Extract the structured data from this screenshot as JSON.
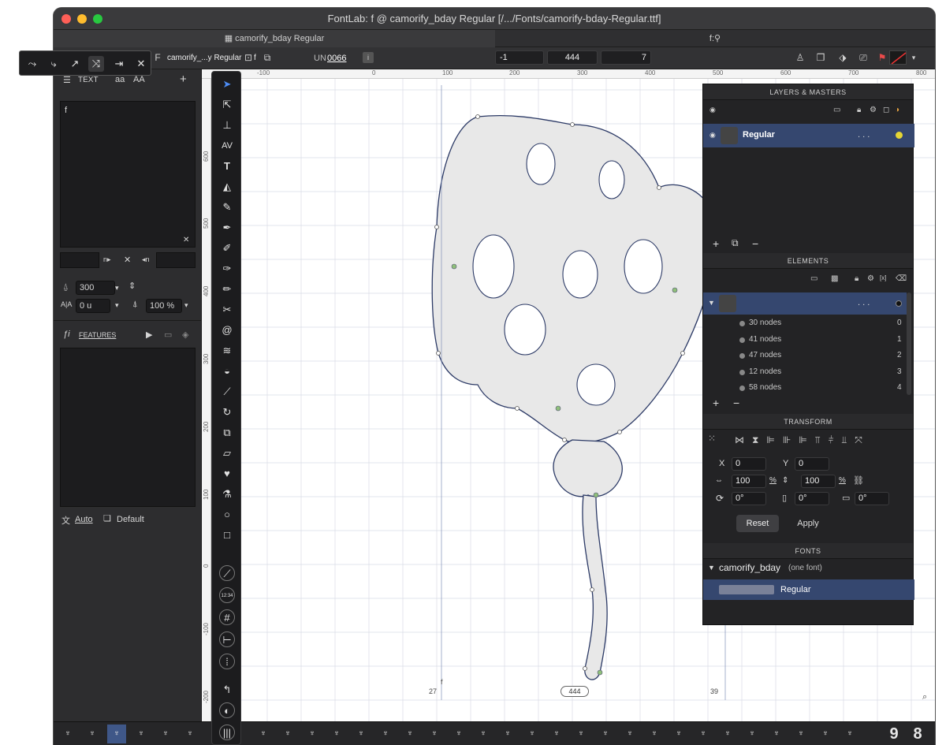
{
  "window": {
    "title": "FontLab: f @ camorify_bday Regular [/.../Fonts/camorify-bday-Regular.ttf]"
  },
  "tabs": [
    {
      "label": "camorify_bday Regular"
    },
    {
      "label": "f:"
    }
  ],
  "toolbar": {
    "font_name": "camorify_...y Regular",
    "glyph_name": "f",
    "un_label": "UN",
    "unicode": "0066",
    "field_a": "-1",
    "field_b": "444",
    "field_c": "7"
  },
  "text_panel": {
    "tab_text": "TEXT",
    "tab_aa": "aa",
    "tab_AA": "AA",
    "content": "f",
    "prefix_label": "n▸",
    "suffix_label": "◂n",
    "font_size": "300",
    "tracking": "0 u",
    "scale": "100 %",
    "features_label": "FEATURES",
    "auto_label": "Auto",
    "default_label": "Default"
  },
  "ruler": {
    "x_ticks": [
      "-100",
      "0",
      "100",
      "200",
      "300",
      "400",
      "500",
      "600",
      "700",
      "800"
    ],
    "y_ticks": [
      "600",
      "500",
      "400",
      "300",
      "200",
      "100",
      "0",
      "-100",
      "-200"
    ]
  },
  "canvas": {
    "left_sb": "27",
    "right_sb": "39",
    "advance": "444",
    "glyph_label": "f"
  },
  "layers": {
    "header": "LAYERS & MASTERS",
    "master_name": "Regular",
    "dots": ". . ."
  },
  "elements": {
    "header": "ELEMENTS",
    "dots": ". . .",
    "items": [
      {
        "label": "30 nodes",
        "index": "0"
      },
      {
        "label": "41 nodes",
        "index": "1"
      },
      {
        "label": "47 nodes",
        "index": "2"
      },
      {
        "label": "12 nodes",
        "index": "3"
      },
      {
        "label": "58 nodes",
        "index": "4"
      }
    ]
  },
  "transform": {
    "header": "TRANSFORM",
    "x_label": "X",
    "x_value": "0",
    "y_label": "Y",
    "y_value": "0",
    "w_value": "100",
    "h_value": "100",
    "pct": "%",
    "rot": "0°",
    "slant_a": "0°",
    "slant_b": "0°",
    "reset": "Reset",
    "apply": "Apply"
  },
  "fonts": {
    "header": "FONTS",
    "family": "camorify_bday",
    "count": "(one font)",
    "style": "Regular"
  },
  "bottom": {
    "nine": "9",
    "eight": "8"
  }
}
